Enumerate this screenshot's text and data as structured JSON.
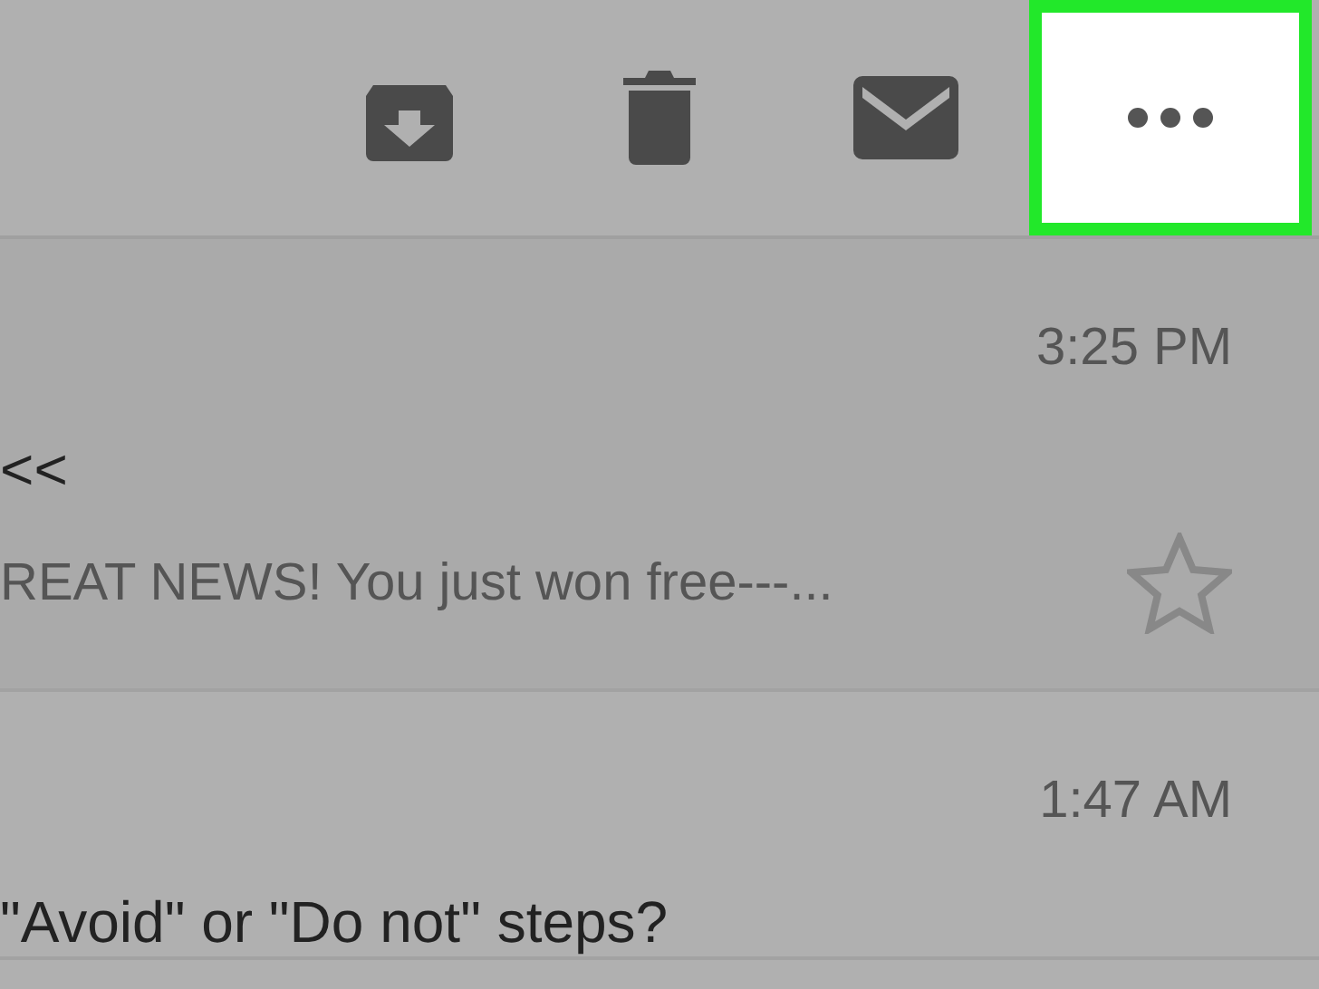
{
  "toolbar": {
    "buttons": [
      {
        "kind": "archive",
        "highlighted": false
      },
      {
        "kind": "trash",
        "highlighted": false
      },
      {
        "kind": "mail",
        "highlighted": false
      },
      {
        "kind": "more",
        "highlighted": true
      }
    ]
  },
  "messages": [
    {
      "time": "3:25 PM",
      "subject": "<<",
      "preview": "REAT NEWS! You just won free---...",
      "starred": false
    },
    {
      "time": "1:47 AM",
      "subject": "\"Avoid\" or \"Do not\" steps?"
    }
  ]
}
